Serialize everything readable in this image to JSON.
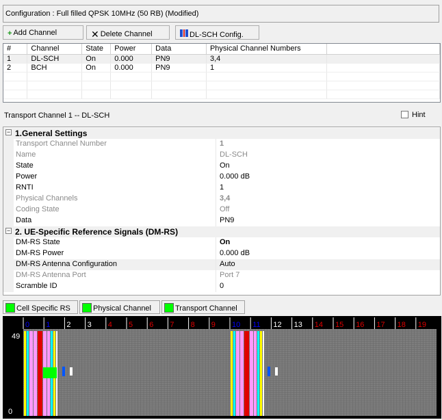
{
  "config_title": "Configuration : Full filled QPSK 10MHz (50 RB) (Modified)",
  "toolbar": {
    "add_label": "Add Channel",
    "delete_label": "Delete Channel",
    "dlsch_label": "DL-SCH Config."
  },
  "colors": {
    "grid_gray": "#808080",
    "red_subframe_label": "#e00000",
    "blue_subframe_label": "#0000ff",
    "legend_green": "#00ff00"
  },
  "channel_table": {
    "headers": [
      "#",
      "Channel",
      "State",
      "Power",
      "Data",
      "Physical Channel Numbers"
    ],
    "rows": [
      [
        "1",
        "DL-SCH",
        "On",
        "0.000",
        "PN9",
        "3,4"
      ],
      [
        "2",
        "BCH",
        "On",
        "0.000",
        "PN9",
        "1"
      ]
    ]
  },
  "transport_title": "Transport Channel 1 -- DL-SCH",
  "hint_label": "Hint",
  "properties": {
    "general_title": "1.General Settings",
    "general": [
      {
        "name": "Transport Channel Number",
        "value": "1"
      },
      {
        "name": "Name",
        "value": "DL-SCH"
      },
      {
        "name": "State",
        "value": "On"
      },
      {
        "name": "Power",
        "value": "0.000 dB"
      },
      {
        "name": "RNTI",
        "value": "1"
      },
      {
        "name": "Physical Channels",
        "value": "3,4"
      },
      {
        "name": "Coding State",
        "value": "Off"
      },
      {
        "name": "Data",
        "value": "PN9"
      }
    ],
    "dmrs_title": "2. UE-Specific Reference Signals (DM-RS)",
    "dmrs": [
      {
        "name": "DM-RS State",
        "value": "On"
      },
      {
        "name": "DM-RS Power",
        "value": "0.000 dB"
      },
      {
        "name": "DM-RS Antenna Configuration",
        "value": "Auto"
      },
      {
        "name": "DM-RS Antenna Port",
        "value": "Port 7"
      },
      {
        "name": "Scramble ID",
        "value": "0"
      }
    ]
  },
  "legend": {
    "cell_rs": "Cell Specific RS",
    "physical": "Physical Channel",
    "transport": "Transport Channel"
  },
  "resource_grid": {
    "subframe_labels": [
      "0",
      "1",
      "2",
      "3",
      "4",
      "5",
      "6",
      "7",
      "8",
      "9",
      "10",
      "11",
      "12",
      "13",
      "14",
      "15",
      "16",
      "17",
      "18",
      "19"
    ],
    "label_colors": [
      "blue",
      "blue",
      "white",
      "white",
      "red",
      "red",
      "red",
      "red",
      "red",
      "red",
      "blue",
      "blue",
      "white",
      "white",
      "red",
      "red",
      "red",
      "red",
      "red",
      "red"
    ],
    "y_top_label": "49",
    "y_bottom_label": "0"
  }
}
